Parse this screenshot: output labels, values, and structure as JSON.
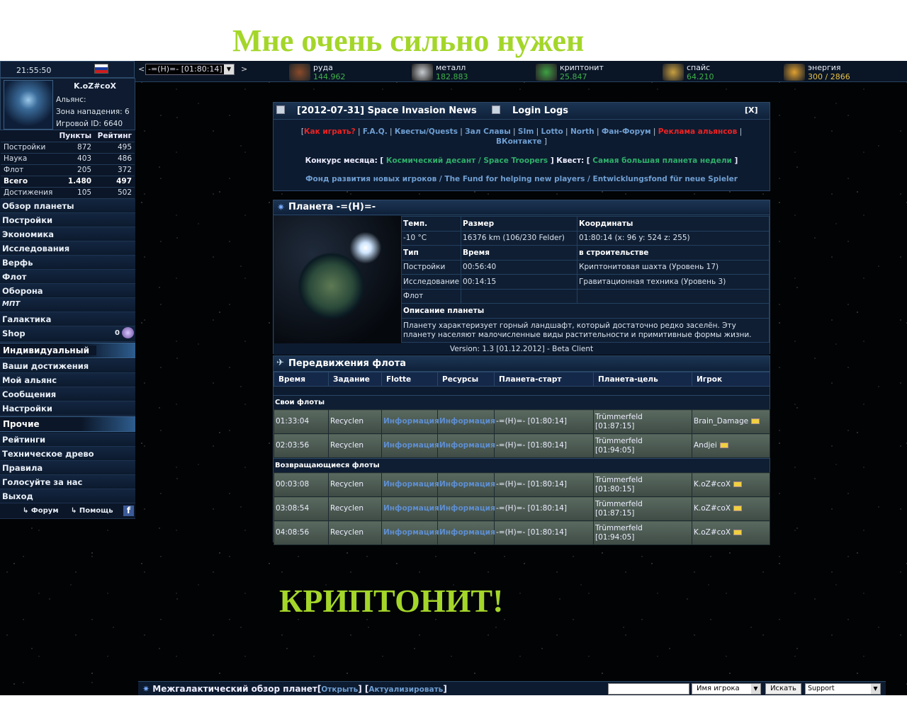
{
  "overlay": {
    "top_text": "Мне очень сильно нужен",
    "bottom_text": "КРИПТОНИТ!"
  },
  "topbar": {
    "time": "21:55:50",
    "planet_select": "-=(H)=- [01:80:14]",
    "prev": "<",
    "next": ">",
    "resources": [
      {
        "name": "руда",
        "value": "144.962",
        "icon": "ore-icon",
        "color": "#8a4a2a"
      },
      {
        "name": "металл",
        "value": "182.883",
        "icon": "metal-icon",
        "color": "#c8ccd0"
      },
      {
        "name": "криптонит",
        "value": "25.847",
        "icon": "kryptonite-icon",
        "color": "#3ea043"
      },
      {
        "name": "спайс",
        "value": "64.210",
        "icon": "spice-icon",
        "color": "#c9a040"
      },
      {
        "name": "энергия",
        "value": "300 / 2866",
        "icon": "energy-icon",
        "color": "#e0a030"
      }
    ]
  },
  "profile": {
    "name": "K.oZ#coX",
    "alliance": "Альянс:",
    "attack_zone": "Зона нападения: 6",
    "game_id": "Игровой ID: 6640"
  },
  "stats": {
    "headers": [
      "",
      "Пункты",
      "Рейтинг"
    ],
    "rows": [
      [
        "Постройки",
        "872",
        "495"
      ],
      [
        "Наука",
        "403",
        "486"
      ],
      [
        "Флот",
        "205",
        "372"
      ],
      [
        "Всего",
        "1.480",
        "497"
      ],
      [
        "Достижения",
        "105",
        "502"
      ]
    ]
  },
  "nav_main": [
    "Обзор планеты",
    "Постройки",
    "Экономика",
    "Исследования",
    "Верфь",
    "Флот",
    "Оборона",
    "МПТ",
    "Галактика",
    "Shop"
  ],
  "shop_count": "0",
  "section_individual": "Индивидуальный",
  "nav_individual": [
    "Ваши достижения",
    "Мой альянс",
    "Сообщения",
    "Настройки"
  ],
  "section_other": "Прочие",
  "nav_other": [
    "Рейтинги",
    "Техническое древо",
    "Правила",
    "Голосуйте за нас",
    "Выход"
  ],
  "left_footer": {
    "forum": "↳ Форум",
    "help": "↳ Помощь",
    "facebook": "f"
  },
  "news": {
    "tab1": "[2012-07-31] Space Invasion News",
    "tab2": "Login Logs",
    "close": "[X]",
    "links": [
      "Как играть?",
      "F.A.Q.",
      "Квесты/Quests",
      "Зал Славы",
      "SIm",
      "Lotto",
      "North",
      "Фан-Форум",
      "Реклама альянсов",
      "ВКонтакте"
    ],
    "contest_label": "Конкурс месяца:",
    "contest_link": "Космический десант / Space Troopers",
    "quest_label": "Квест:",
    "quest_link": "Самая большая планета недели",
    "fund": "Фонд развития новых игроков / The Fund for helping new players / Entwicklungsfond für neue Spieler"
  },
  "planet": {
    "title": "Планета -=(H)=-",
    "headers": [
      "Темп.",
      "Размер",
      "Координаты"
    ],
    "temp": "-10 °C",
    "size": "16376 km (106/230 Felder)",
    "coords": "01:80:14 (x: 96 y: 524 z: 255)",
    "type_header": "Тип",
    "time_header": "Время",
    "building_header": "в строительстве",
    "rows": [
      [
        "Постройки",
        "00:56:40",
        "Криптонитовая шахта (Уровень 17)"
      ],
      [
        "Исследование",
        "00:14:15",
        "Гравитационная техника (Уровень 3)"
      ],
      [
        "Флот",
        "",
        ""
      ]
    ],
    "desc_header": "Описание планеты",
    "description": "Планету характеризует горный ландшафт, который достаточно редко заселён. Эту планету населяют малочисленные виды растительности и примитивные формы жизни.",
    "version": "Version: 1.3 [01.12.2012] - Beta Client"
  },
  "fleet": {
    "title": "Передвижения флота",
    "headers": [
      "Время",
      "Задание",
      "Flotte",
      "Ресурсы",
      "Планета-старт",
      "Планета-цель",
      "Игрок"
    ],
    "own_label": "Свои флоты",
    "own": [
      [
        "01:33:04",
        "Recyclen",
        "Информация",
        "Информация",
        "-=(H)=- [01:80:14]",
        "Trümmerfeld",
        "[01:87:15]",
        "Brain_Damage"
      ],
      [
        "02:03:56",
        "Recyclen",
        "Информация",
        "Информация",
        "-=(H)=- [01:80:14]",
        "Trümmerfeld",
        "[01:94:05]",
        "Andjei"
      ]
    ],
    "returning_label": "Возвращающиеся флоты",
    "returning": [
      [
        "00:03:08",
        "Recyclen",
        "Информация",
        "Информация",
        "-=(H)=- [01:80:14]",
        "Trümmerfeld",
        "[01:80:15]",
        "K.oZ#coX"
      ],
      [
        "03:08:54",
        "Recyclen",
        "Информация",
        "Информация",
        "-=(H)=- [01:80:14]",
        "Trümmerfeld",
        "[01:87:15]",
        "K.oZ#coX"
      ],
      [
        "04:08:56",
        "Recyclen",
        "Информация",
        "Информация",
        "-=(H)=- [01:80:14]",
        "Trümmerfeld",
        "[01:94:05]",
        "K.oZ#coX"
      ]
    ]
  },
  "bottom": {
    "title": "Межгалактический обзор планет",
    "open": "Открыть",
    "refresh": "Актуализировать",
    "search_mode": "Имя игрока",
    "search_button": "Искать",
    "support": "Support"
  }
}
